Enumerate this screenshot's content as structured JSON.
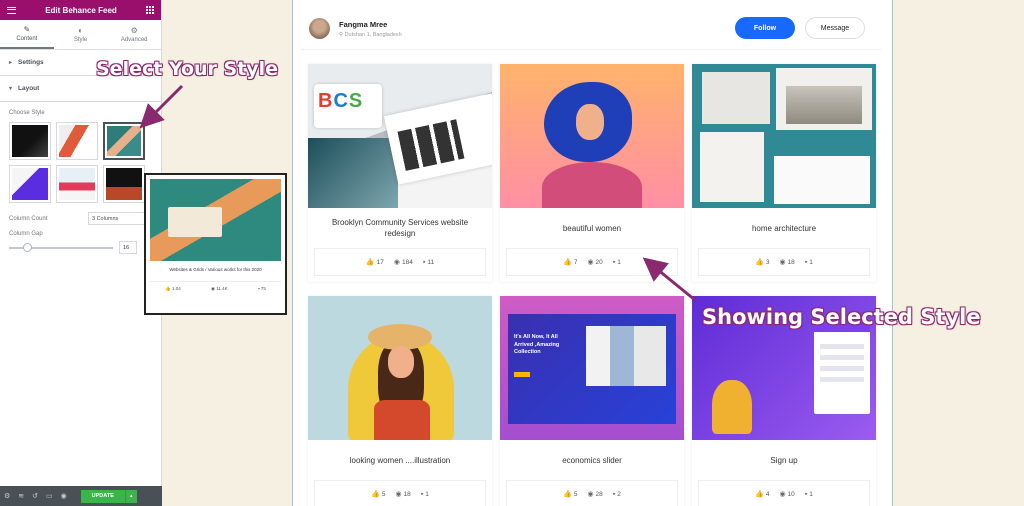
{
  "panel": {
    "title": "Edit Behance Feed",
    "tabs": [
      {
        "label": "Content",
        "icon": "pencil-icon"
      },
      {
        "label": "Style",
        "icon": "half-circle-icon"
      },
      {
        "label": "Advanced",
        "icon": "gear-icon"
      }
    ],
    "settings_label": "Settings",
    "layout_label": "Layout",
    "choose_style_label": "Choose Style",
    "column_count_label": "Column Count",
    "column_count_value": "3 Columns",
    "column_gap_label": "Column Gap",
    "column_gap_value": "16",
    "update_label": "UPDATE"
  },
  "preview_popup": {
    "caption": "Websites & Grids / Various works for this 2020",
    "likes": "1.04",
    "views": "11.4K",
    "comments": "75"
  },
  "profile": {
    "name": "Fangma Mree",
    "location": "Dutshan 1, Bangladesh",
    "follow_label": "Follow",
    "message_label": "Message"
  },
  "cards": [
    {
      "title": "Brooklyn Community Services website redesign",
      "likes": "17",
      "views": "184",
      "comments": "11",
      "logo_text": "BCS"
    },
    {
      "title": "beautiful women",
      "likes": "7",
      "views": "20",
      "comments": "1"
    },
    {
      "title": "home architecture",
      "likes": "3",
      "views": "18",
      "comments": "1"
    },
    {
      "title": "looking women ....illustration",
      "likes": "5",
      "views": "18",
      "comments": "1"
    },
    {
      "title": "economics slider",
      "likes": "5",
      "views": "28",
      "comments": "2",
      "slide_text": "It's All Now, It All Arrived ,Amazing Collection"
    },
    {
      "title": "Sign up",
      "likes": "4",
      "views": "10",
      "comments": "1"
    }
  ],
  "annotations": {
    "select_style": "Select Your Style",
    "showing_style": "Showing Selected Style"
  },
  "colors": {
    "header": "#9a0e6c",
    "follow": "#1769ff",
    "update": "#39b54a",
    "annotation": "#8a2a6e"
  }
}
